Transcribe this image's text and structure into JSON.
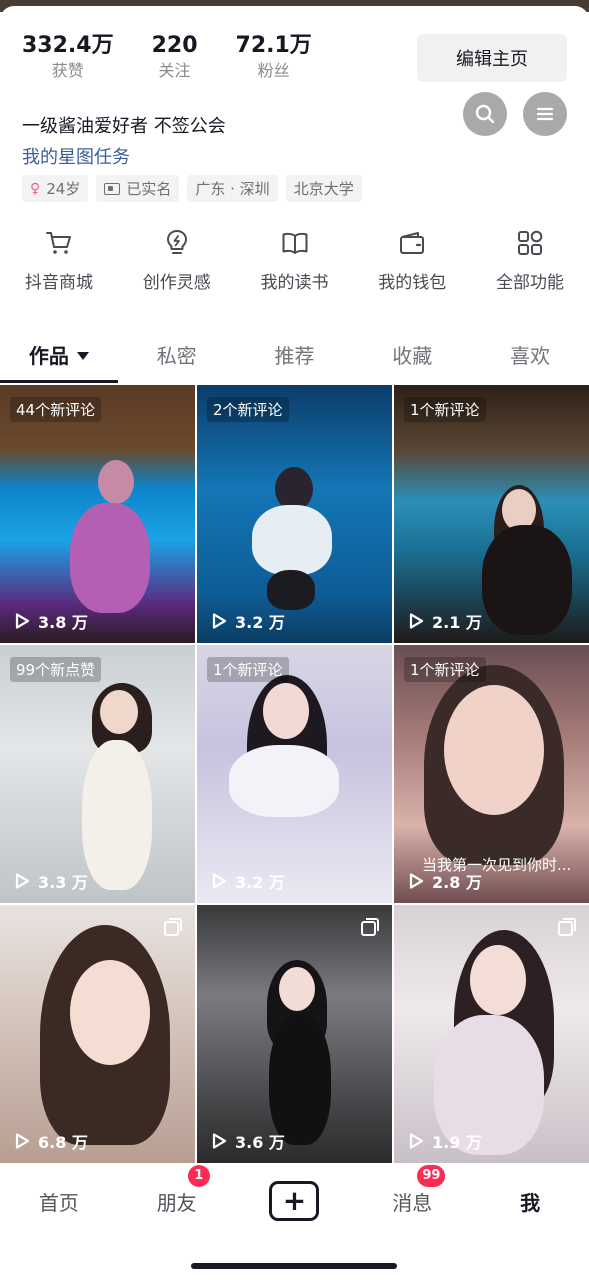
{
  "profile": {
    "stats": [
      {
        "value": "332.4万",
        "label": "获赞"
      },
      {
        "value": "220",
        "label": "关注"
      },
      {
        "value": "72.1万",
        "label": "粉丝"
      }
    ],
    "edit_button": "编辑主页",
    "bio": "一级酱油爱好者 不签公会",
    "star_link": "我的星图任务",
    "tags": [
      "24岁",
      "已实名",
      "广东 · 深圳",
      "北京大学"
    ]
  },
  "functions": [
    {
      "icon": "cart-icon",
      "label": "抖音商城"
    },
    {
      "icon": "lightbulb-icon",
      "label": "创作灵感"
    },
    {
      "icon": "book-icon",
      "label": "我的读书"
    },
    {
      "icon": "wallet-icon",
      "label": "我的钱包"
    },
    {
      "icon": "grid-icon",
      "label": "全部功能"
    }
  ],
  "tabs": [
    "作品",
    "私密",
    "推荐",
    "收藏",
    "喜欢"
  ],
  "videos": [
    {
      "badge": "44个新评论",
      "plays": "3.8 万"
    },
    {
      "badge": "2个新评论",
      "plays": "3.2 万"
    },
    {
      "badge": "1个新评论",
      "plays": "2.1 万"
    },
    {
      "badge": "99个新点赞",
      "plays": "3.3 万"
    },
    {
      "badge": "1个新评论",
      "plays": "3.2 万"
    },
    {
      "badge": "1个新评论",
      "plays": "2.8 万",
      "caption": "当我第一次见到你时..."
    },
    {
      "plays": "6.8 万"
    },
    {
      "plays": "3.6 万"
    },
    {
      "plays": "1.9 万"
    }
  ],
  "bottom_nav": {
    "home": "首页",
    "friends": "朋友",
    "friends_badge": "1",
    "plus": "+",
    "messages": "消息",
    "messages_badge": "99",
    "me": "我"
  },
  "colors": {
    "accent": "#fe2c55",
    "link": "#3a5f9b"
  }
}
